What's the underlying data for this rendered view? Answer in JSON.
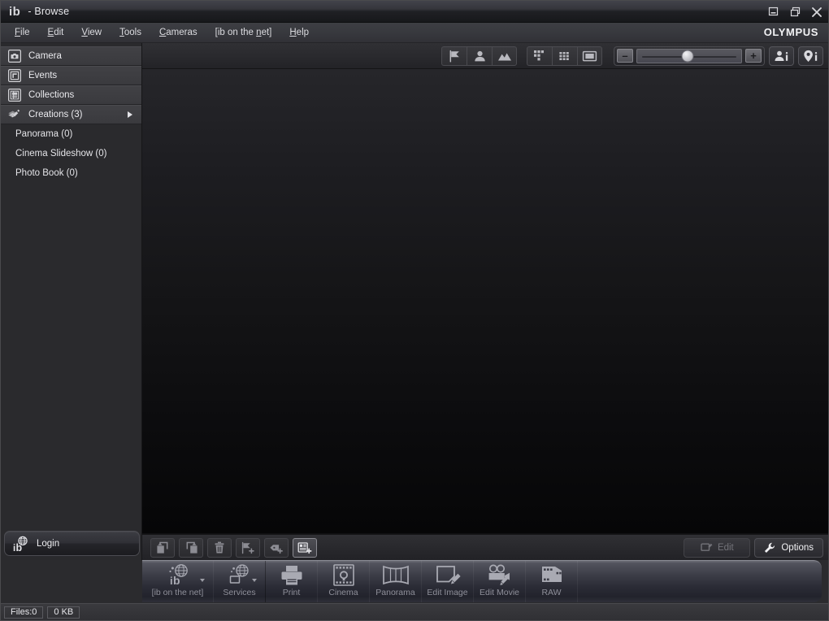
{
  "window": {
    "logo_i": "i",
    "logo_b": "b",
    "title": "- Browse",
    "brand": "OLYMPUS",
    "controls": [
      {
        "name": "minimize-button",
        "glyph": "minimize"
      },
      {
        "name": "restore-button",
        "glyph": "restore"
      },
      {
        "name": "close-button",
        "glyph": "close"
      }
    ]
  },
  "menubar": {
    "items": [
      {
        "label": "File",
        "accel": "F"
      },
      {
        "label": "Edit",
        "accel": "E"
      },
      {
        "label": "View",
        "accel": "V"
      },
      {
        "label": "Tools",
        "accel": "T"
      },
      {
        "label": "Cameras",
        "accel": "C"
      },
      {
        "label": "[ib on the net]",
        "accel": "n"
      },
      {
        "label": "Help",
        "accel": "H"
      }
    ]
  },
  "sidebar": {
    "nav": [
      {
        "label": "Camera",
        "icon": "camera-icon"
      },
      {
        "label": "Events",
        "icon": "events-icon"
      },
      {
        "label": "Collections",
        "icon": "collections-icon"
      },
      {
        "label": "Creations (3)",
        "icon": "creations-icon",
        "expandable": true
      }
    ],
    "subitems": [
      {
        "label": "Panorama (0)"
      },
      {
        "label": "Cinema Slideshow (0)"
      },
      {
        "label": "Photo Book (0)"
      }
    ],
    "login": {
      "label": "Login",
      "icon": "ib-globe-icon"
    }
  },
  "toolbar": {
    "filters": [
      {
        "name": "flag-filter-button",
        "icon": "flag-icon"
      },
      {
        "name": "people-filter-button",
        "icon": "person-icon"
      },
      {
        "name": "scene-filter-button",
        "icon": "mountain-icon"
      }
    ],
    "views": [
      {
        "name": "calendar-view-button",
        "icon": "scatter-grid-icon"
      },
      {
        "name": "grid-view-button",
        "icon": "grid-icon"
      },
      {
        "name": "single-view-button",
        "icon": "single-frame-icon"
      }
    ],
    "zoom": {
      "minus_label": "–",
      "plus_label": "+",
      "value": 45
    },
    "info_buttons": [
      {
        "name": "people-info-button",
        "icon": "person-info-icon"
      },
      {
        "name": "place-info-button",
        "icon": "place-info-icon"
      }
    ]
  },
  "bottombar": {
    "actions": [
      {
        "name": "rotate-left-button",
        "icon": "rotate-left-icon",
        "active": false
      },
      {
        "name": "rotate-right-button",
        "icon": "rotate-right-icon",
        "active": false
      },
      {
        "name": "delete-button",
        "icon": "trash-icon",
        "active": false
      },
      {
        "name": "add-flag-button",
        "icon": "flag-plus-icon",
        "active": false
      },
      {
        "name": "add-tag-button",
        "icon": "tag-plus-icon",
        "active": false
      },
      {
        "name": "add-info-button",
        "icon": "info-plus-icon",
        "active": true
      }
    ],
    "edit_label": "Edit",
    "options_label": "Options"
  },
  "dock": {
    "items": [
      {
        "label": "[ib on the net]",
        "icon": "ib-net-icon",
        "caret": true,
        "wide": true
      },
      {
        "label": "Services",
        "icon": "services-icon",
        "caret": true
      },
      {
        "label": "Print",
        "icon": "printer-icon",
        "caret": false
      },
      {
        "label": "Cinema",
        "icon": "cinema-icon",
        "caret": false
      },
      {
        "label": "Panorama",
        "icon": "panorama-icon",
        "caret": false
      },
      {
        "label": "Edit Image",
        "icon": "edit-image-icon",
        "caret": false
      },
      {
        "label": "Edit Movie",
        "icon": "edit-movie-icon",
        "caret": false
      },
      {
        "label": "RAW",
        "icon": "raw-film-icon",
        "caret": false
      }
    ]
  },
  "statusbar": {
    "files": "Files:0",
    "size": "0 KB"
  },
  "colors": {
    "sidebar_bg": "#2a2a2d",
    "chrome_bg": "#2b2b2e",
    "canvas_top": "#26262a",
    "canvas_bottom": "#060607",
    "text": "#e8e8ec",
    "muted_text": "#8e8f99"
  }
}
